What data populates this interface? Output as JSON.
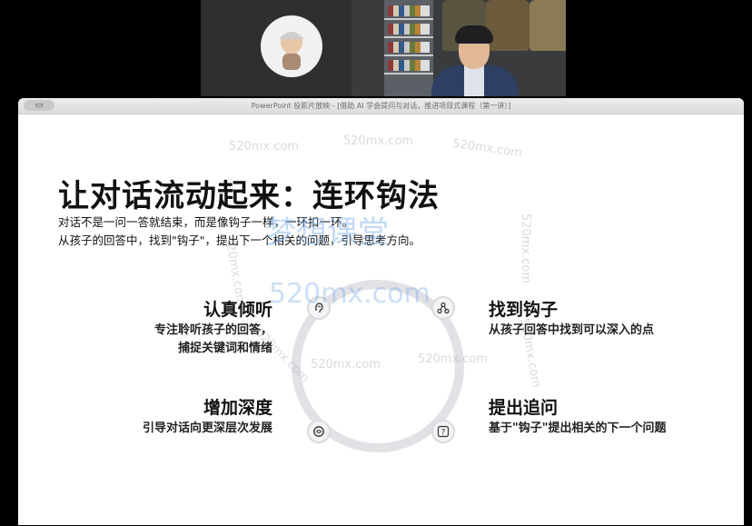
{
  "window": {
    "title": "PowerPoint 投影片放映 - [借助 AI 学会提问与对话，推进项目式课程（第一讲）]",
    "toolbar_button_icon": "window-icon"
  },
  "slide": {
    "title": "让对话流动起来：连环钩法",
    "subtitle_lines": [
      "对话不是一问一答就结束，而是像钩子一样，一环扣一环。",
      "从孩子的回答中，找到\"钩子\"，提出下一个相关的问题，引导思考方向。"
    ],
    "quadrants": {
      "top_left": {
        "title": "认真倾听",
        "desc_lines": [
          "专注聆听孩子的回答，",
          "捕捉关键词和情绪"
        ],
        "icon": "ear-icon"
      },
      "top_right": {
        "title": "找到钩子",
        "desc_lines": [
          "从孩子回答中找到可以深入的点"
        ],
        "icon": "link-icon"
      },
      "bottom_left": {
        "title": "增加深度",
        "desc_lines": [
          "引导对话向更深层次发展"
        ],
        "icon": "brain-icon"
      },
      "bottom_right": {
        "title": "提出追问",
        "desc_lines": [
          "基于\"钩子\"提出相关的下一个问题"
        ],
        "icon": "question-icon"
      }
    }
  },
  "watermarks": {
    "small": "520mx.com",
    "big_cn": "梦想课堂",
    "big_en": "520mx.com"
  },
  "colors": {
    "ring": "#e1e1e6",
    "text": "#111111"
  }
}
